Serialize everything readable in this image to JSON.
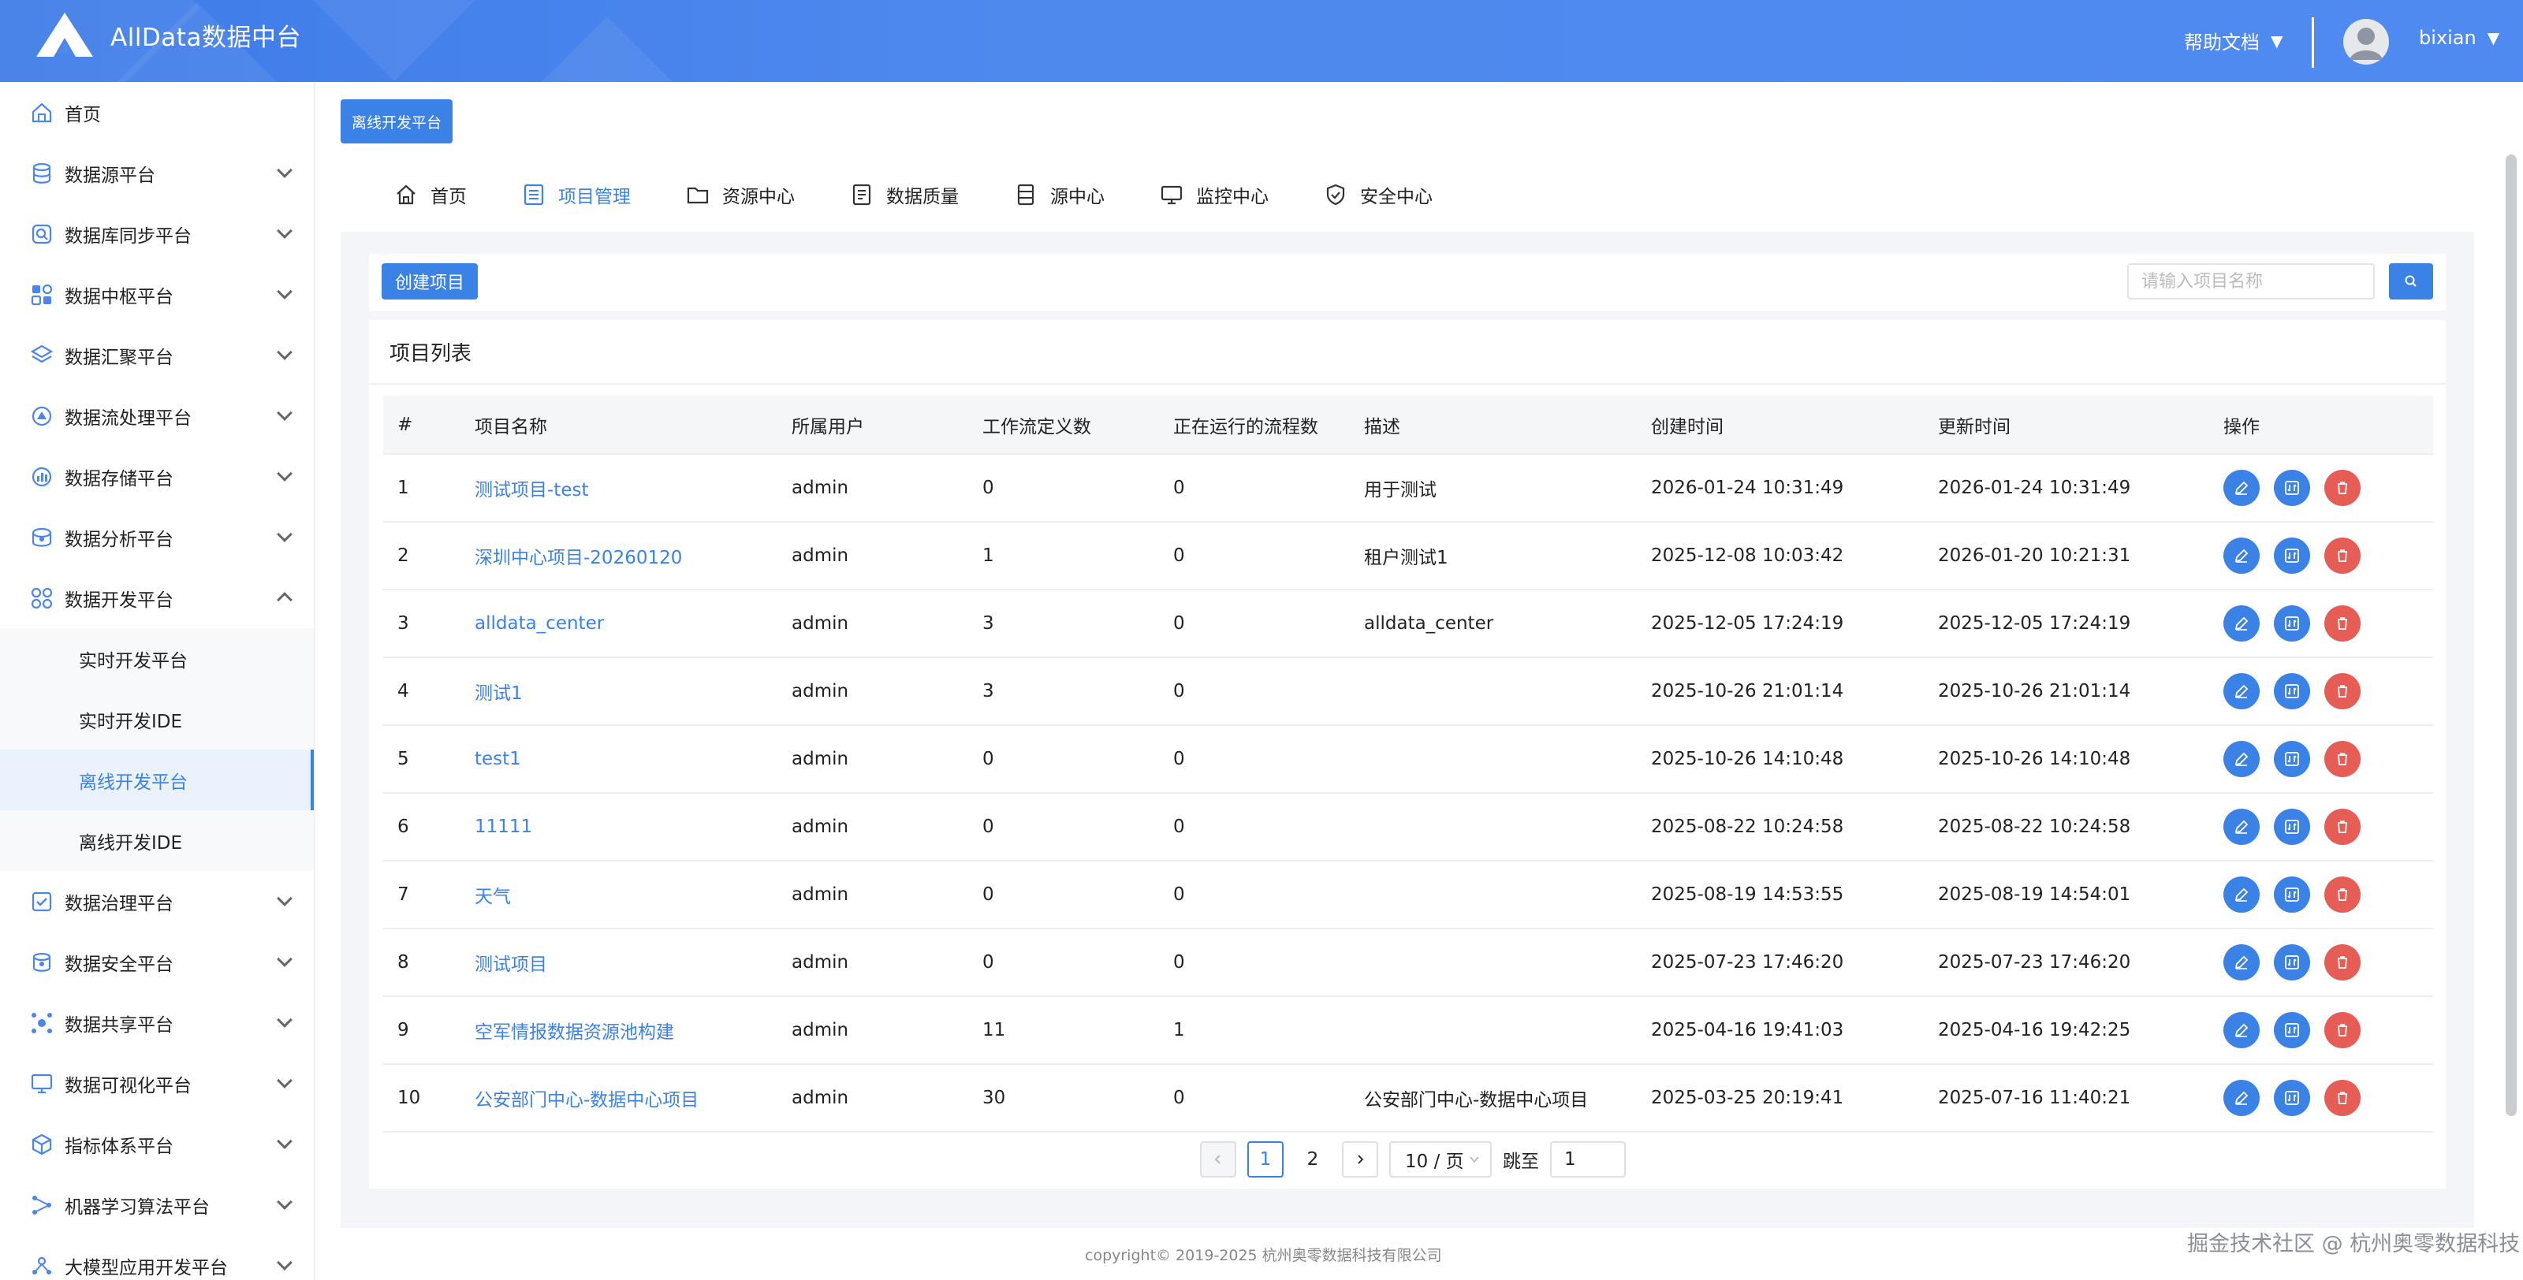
{
  "header": {
    "brand": "AllData数据中台",
    "help_label": "帮助文档",
    "username": "bixian"
  },
  "sidebar": {
    "items": [
      {
        "label": "首页",
        "icon": "home-icon",
        "expandable": false
      },
      {
        "label": "数据源平台",
        "icon": "database-icon",
        "expandable": true
      },
      {
        "label": "数据库同步平台",
        "icon": "sync-icon",
        "expandable": true
      },
      {
        "label": "数据中枢平台",
        "icon": "grid-icon",
        "expandable": true
      },
      {
        "label": "数据汇聚平台",
        "icon": "layers-icon",
        "expandable": true
      },
      {
        "label": "数据流处理平台",
        "icon": "stream-icon",
        "expandable": true
      },
      {
        "label": "数据存储平台",
        "icon": "chart-icon",
        "expandable": true
      },
      {
        "label": "数据分析平台",
        "icon": "analysis-icon",
        "expandable": true
      },
      {
        "label": "数据开发平台",
        "icon": "dev-icon",
        "expandable": true,
        "expanded": true
      }
    ],
    "sub_items": [
      {
        "label": "实时开发平台"
      },
      {
        "label": "实时开发IDE"
      },
      {
        "label": "离线开发平台",
        "active": true
      },
      {
        "label": "离线开发IDE"
      }
    ],
    "items_after": [
      {
        "label": "数据治理平台",
        "icon": "governance-icon"
      },
      {
        "label": "数据安全平台",
        "icon": "security-icon"
      },
      {
        "label": "数据共享平台",
        "icon": "share-icon"
      },
      {
        "label": "数据可视化平台",
        "icon": "monitor-icon"
      },
      {
        "label": "指标体系平台",
        "icon": "cube-icon"
      },
      {
        "label": "机器学习算法平台",
        "icon": "ml-icon"
      },
      {
        "label": "大模型应用开发平台",
        "icon": "ai-icon"
      }
    ]
  },
  "page_tag": "离线开发平台",
  "tabs": [
    {
      "label": "首页",
      "icon": "home-icon"
    },
    {
      "label": "项目管理",
      "icon": "list-icon",
      "active": true
    },
    {
      "label": "资源中心",
      "icon": "folder-icon"
    },
    {
      "label": "数据质量",
      "icon": "quality-icon"
    },
    {
      "label": "源中心",
      "icon": "source-icon"
    },
    {
      "label": "监控中心",
      "icon": "monitor-icon"
    },
    {
      "label": "安全中心",
      "icon": "shield-icon"
    }
  ],
  "toolbar": {
    "create_label": "创建项目",
    "search_placeholder": "请输入项目名称"
  },
  "table": {
    "title": "项目列表",
    "columns": [
      "#",
      "项目名称",
      "所属用户",
      "工作流定义数",
      "正在运行的流程数",
      "描述",
      "创建时间",
      "更新时间",
      "操作"
    ],
    "rows": [
      {
        "idx": "1",
        "name": "测试项目-test",
        "user": "admin",
        "defs": "0",
        "running": "0",
        "desc": "用于测试",
        "created": "2026-01-24 10:31:49",
        "updated": "2026-01-24 10:31:49"
      },
      {
        "idx": "2",
        "name": "深圳中心项目-20260120",
        "user": "admin",
        "defs": "1",
        "running": "0",
        "desc": "租户测试1",
        "created": "2025-12-08 10:03:42",
        "updated": "2026-01-20 10:21:31"
      },
      {
        "idx": "3",
        "name": "alldata_center",
        "user": "admin",
        "defs": "3",
        "running": "0",
        "desc": "alldata_center",
        "created": "2025-12-05 17:24:19",
        "updated": "2025-12-05 17:24:19"
      },
      {
        "idx": "4",
        "name": "测试1",
        "user": "admin",
        "defs": "3",
        "running": "0",
        "desc": "",
        "created": "2025-10-26 21:01:14",
        "updated": "2025-10-26 21:01:14"
      },
      {
        "idx": "5",
        "name": "test1",
        "user": "admin",
        "defs": "0",
        "running": "0",
        "desc": "",
        "created": "2025-10-26 14:10:48",
        "updated": "2025-10-26 14:10:48"
      },
      {
        "idx": "6",
        "name": "11111",
        "user": "admin",
        "defs": "0",
        "running": "0",
        "desc": "",
        "created": "2025-08-22 10:24:58",
        "updated": "2025-08-22 10:24:58"
      },
      {
        "idx": "7",
        "name": "天气",
        "user": "admin",
        "defs": "0",
        "running": "0",
        "desc": "",
        "created": "2025-08-19 14:53:55",
        "updated": "2025-08-19 14:54:01"
      },
      {
        "idx": "8",
        "name": "测试项目",
        "user": "admin",
        "defs": "0",
        "running": "0",
        "desc": "",
        "created": "2025-07-23 17:46:20",
        "updated": "2025-07-23 17:46:20"
      },
      {
        "idx": "9",
        "name": "空军情报数据资源池构建",
        "user": "admin",
        "defs": "11",
        "running": "1",
        "desc": "",
        "created": "2025-04-16 19:41:03",
        "updated": "2025-04-16 19:42:25"
      },
      {
        "idx": "10",
        "name": "公安部门中心-数据中心项目",
        "user": "admin",
        "defs": "30",
        "running": "0",
        "desc": "公安部门中心-数据中心项目",
        "created": "2025-03-25 20:19:41",
        "updated": "2025-07-16 11:40:21"
      }
    ]
  },
  "pagination": {
    "pages": [
      "1",
      "2"
    ],
    "current": "1",
    "page_size": "10 / 页",
    "jump_label": "跳至",
    "jump_value": "1"
  },
  "footer": "copyright© 2019-2025 杭州奥零数据科技有限公司",
  "watermark": "掘金技术社区 @ 杭州奥零数据科技",
  "colors": {
    "primary": "#3b82e6",
    "danger": "#e55d55",
    "header_start": "#3d7be8",
    "header_end": "#4f8af0"
  }
}
